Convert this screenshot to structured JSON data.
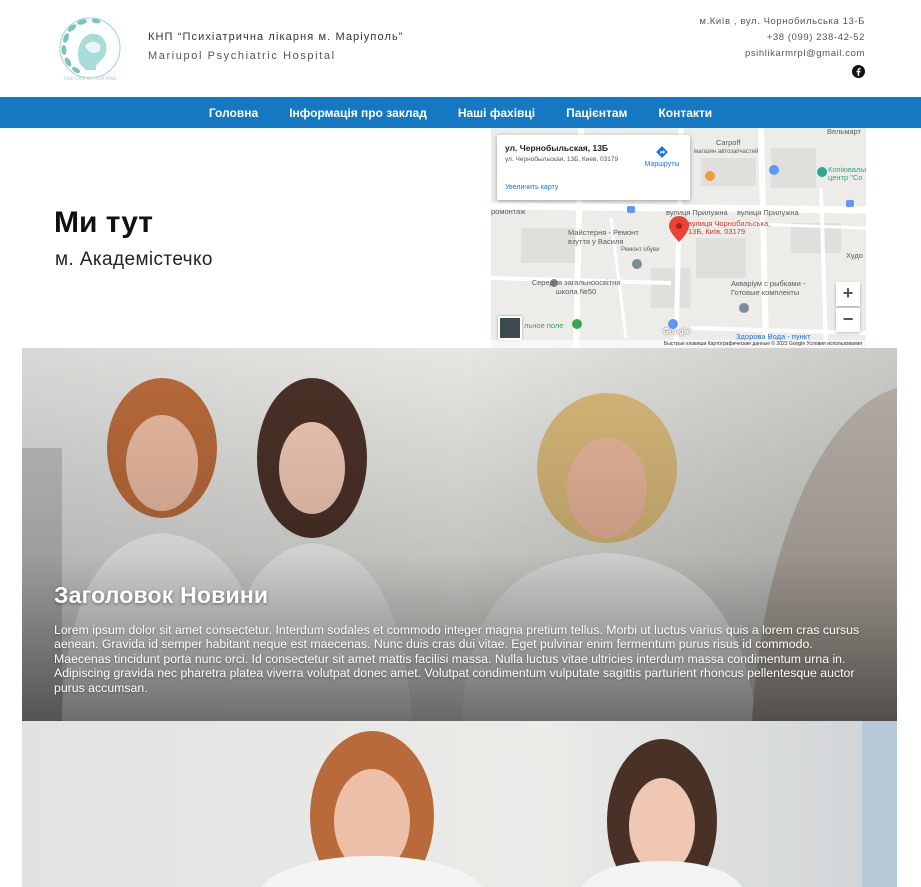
{
  "header": {
    "name_ua": "КНП “Психіатрична лікарня м. Маріуполь”",
    "name_en": "Mariupol Psychiatric Hospital",
    "address": "м.Київ , вул. Чорнобильська 13-Б",
    "phone": "+38 (099) 238-42-52",
    "email": "psihlikarmrpl@gmail.com",
    "social_icon": "facebook-icon"
  },
  "nav": {
    "items": [
      "Головна",
      "Інформація про заклад",
      "Наші фахівці",
      "Пацієнтам",
      "Контакти"
    ]
  },
  "location": {
    "title": "Ми тут",
    "subtitle": "м. Академістечко"
  },
  "map": {
    "card_title": "ул. Чернобыльская, 13Б",
    "card_address": "ул. Чернобыльская, 13Б, Киев, 03179",
    "enlarge_label": "Увеличить карту",
    "route_label": "Маршруты",
    "pin_label": "вулиця Чорнобильська, 13Б, Київ, 03179",
    "labels": [
      "Вельмарт",
      "Carpoff",
      "магазин автозапчастей",
      "Копіювальний центр \"Со",
      "вулиця Прилужна",
      "вулиця Прилужна",
      "ромонтаж",
      "Майстерня - Ремонт взуття у Василя",
      "Ремонт обуви",
      "Худо",
      "Середня загальноосвітня школа №50",
      "Акваріум с рыбками - Готовые комплекты",
      "льное поле",
      "Здорова Вода - пункт"
    ],
    "footer": "Быстрые клавиши   Картографические данные © 2023 Google   Условия использования",
    "zoom_in": "+",
    "zoom_out": "−",
    "google": "Google"
  },
  "news": {
    "title": "Заголовок Новини",
    "text": "Lorem ipsum dolor sit amet consectetur. Interdum sodales et commodo integer magna pretium tellus. Morbi ut luctus varius quis a lorem cras cursus aenean. Gravida id semper habitant neque est maecenas. Nunc duis cras dui vitae. Eget pulvinar enim fermentum purus risus id commodo. Maecenas tincidunt porta nunc orci. Id consectetur sit amet mattis facilisi massa. Nulla luctus vitae ultricies interdum massa condimentum urna in. Adipiscing gravida nec pharetra platea viverra volutpat donec amet. Volutpat condimentum vulputate sagittis parturient rhoncus pellentesque auctor purus accumsan."
  },
  "colors": {
    "nav_bg": "#1479c2",
    "logo_teal": "#7cc3bf",
    "map_pin": "#d93025"
  }
}
